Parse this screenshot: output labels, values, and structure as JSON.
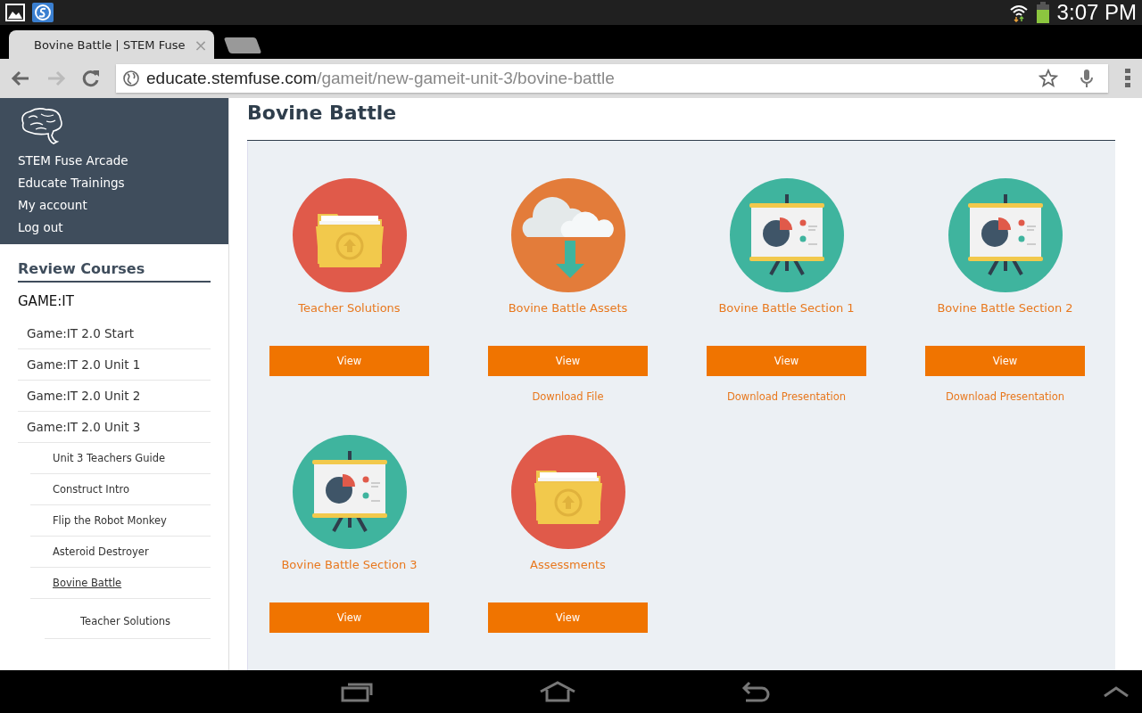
{
  "status_bar": {
    "time": "3:07 PM"
  },
  "browser": {
    "tab": {
      "title": "Bovine Battle | STEM Fuse",
      "close": "×",
      "selected": true
    },
    "url": {
      "domain": "educate.stemfuse.com",
      "path": "/gameit/new-gameit-unit-3/bovine-battle"
    }
  },
  "sidebar": {
    "top_links": [
      "STEM Fuse Arcade",
      "Educate Trainings",
      "My account",
      "Log out"
    ],
    "heading": "Review Courses",
    "course": "GAME:IT",
    "items": [
      {
        "label": "Game:IT 2.0 Start",
        "selected": false
      },
      {
        "label": "Game:IT 2.0 Unit 1",
        "selected": false
      },
      {
        "label": "Game:IT 2.0 Unit 2",
        "selected": false
      },
      {
        "label": "Game:IT 2.0 Unit 3",
        "selected": false,
        "children": [
          {
            "label": "Unit 3 Teachers Guide",
            "selected": false
          },
          {
            "label": "Construct Intro",
            "selected": false
          },
          {
            "label": "Flip the Robot Monkey",
            "selected": false
          },
          {
            "label": "Asteroid Destroyer",
            "selected": false
          },
          {
            "label": "Bovine Battle",
            "selected": true,
            "children": [
              {
                "label": "Teacher Solutions",
                "selected": false
              }
            ]
          }
        ]
      }
    ]
  },
  "page": {
    "title": "Bovine Battle",
    "resources": [
      {
        "kind": "folder",
        "title": "Teacher Solutions",
        "button": "View"
      },
      {
        "kind": "cloud",
        "title": "Bovine Battle Assets",
        "button": "View",
        "link": "Download File"
      },
      {
        "kind": "presentation",
        "title": "Bovine Battle Section 1",
        "button": "View",
        "link": "Download Presentation"
      },
      {
        "kind": "presentation",
        "title": "Bovine Battle Section 2",
        "button": "View",
        "link": "Download Presentation"
      },
      {
        "kind": "presentation",
        "title": "Bovine Battle Section 3",
        "button": "View"
      },
      {
        "kind": "folder",
        "title": "Assessments",
        "button": "View"
      }
    ]
  }
}
